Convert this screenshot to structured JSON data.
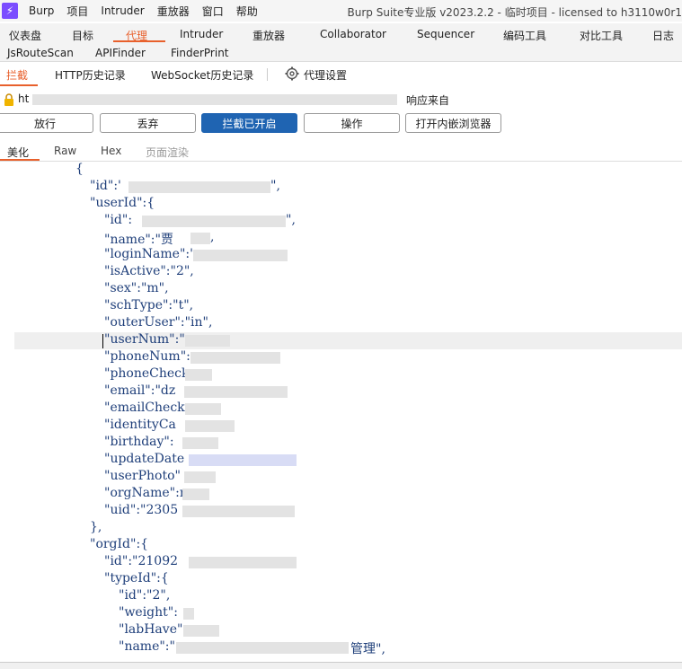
{
  "menubar": {
    "items": [
      "Burp",
      "项目",
      "Intruder",
      "重放器",
      "窗口",
      "帮助"
    ],
    "title": "Burp Suite专业版  v2023.2.2 - 临时项目 - licensed to h3110w0r1"
  },
  "tool_tabs": {
    "row1": [
      "仪表盘",
      "目标",
      "代理",
      "Intruder",
      "重放器",
      "Collaborator",
      "Sequencer",
      "编码工具",
      "对比工具",
      "日志"
    ],
    "row2": [
      "JsRouteScan",
      "APIFinder",
      "FinderPrint"
    ],
    "active": "代理"
  },
  "sub_tabs": {
    "items": [
      "拦截",
      "HTTP历史记录",
      "WebSocket历史记录"
    ],
    "active": "拦截",
    "settings_label": "代理设置"
  },
  "request": {
    "prefix": "ht",
    "suffix": "响应来自"
  },
  "buttons": {
    "forward": "放行",
    "drop": "丢弃",
    "intercept": "拦截已开启",
    "action": "操作",
    "browser": "打开内嵌浏览器"
  },
  "editor_tabs": {
    "items": [
      "美化",
      "Raw",
      "Hex",
      "页面渲染"
    ],
    "active": "美化"
  },
  "code_lines": [
    "{",
    "\"id\":'",
    "\",",
    "\"userId\":{",
    "\"id\":",
    "\",",
    "\"name\":\"贾",
    ",",
    "\"loginName\":'",
    "\"isActive\":\"2\",",
    "\"sex\":\"m\",",
    "\"schType\":\"t\",",
    "\"outerUser\":\"in\",",
    "\"userNum\":\"",
    "\"phoneNum\":",
    "\"phoneCheck",
    "\"email\":\"dz",
    "\"emailCheck",
    "\"identityCa",
    "\"birthday\":",
    "\"updateDate",
    "\"userPhoto\"",
    "\"orgName\":n",
    "\"uid\":\"2305",
    "},",
    "\"orgId\":{",
    "\"id\":\"21092",
    "\"typeId\":{",
    "\"id\":\"2\",",
    "\"weight\":",
    "\"labHave\"",
    "\"name\":\"",
    "管理\","
  ],
  "colors": {
    "accent": "#e8602c",
    "primary_button": "#1f64b2",
    "code_text": "#1f3f7a",
    "logo": "#7b4dff"
  }
}
